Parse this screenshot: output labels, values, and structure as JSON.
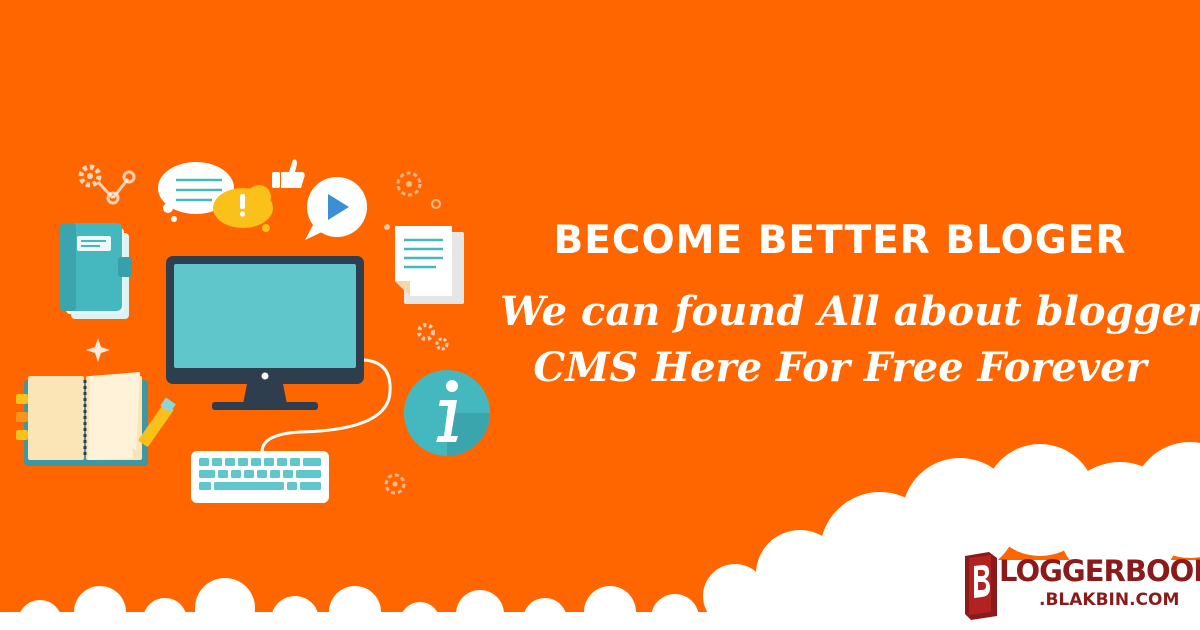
{
  "banner": {
    "headline": "BECOME BETTER BLOGER",
    "tagline_line1": "We can found All about blogger",
    "tagline_line2": "CMS Here For Free Forever"
  },
  "logo": {
    "name": "LOGGERBOOK",
    "domain": ".BLAKBIN.COM"
  },
  "colors": {
    "background": "#FF6600",
    "accent_teal": "#45B7BF",
    "cloud": "#FFFFFF",
    "logo_text": "#8B1A1A",
    "dark_navy": "#2E3E4E"
  }
}
